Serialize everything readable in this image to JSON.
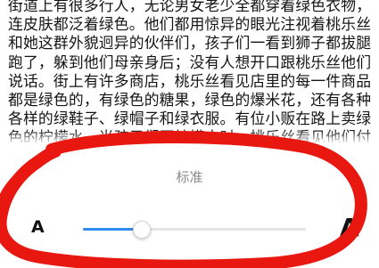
{
  "reader": {
    "paragraph": "街道上有很多行人，无论男女老少全都穿着绿色衣物，连皮肤都泛着绿色。他们都用惊异的眼光注视着桃乐丝和她这群外貌迥异的伙伴们，孩子们一看到狮子都拔腿跑了，躲到他们母亲身后；没有人想开口跟桃乐丝他们说话。街上有许多商店，桃乐丝看见店里的每一件商品都是绿色的，有绿色的糖果，绿色的爆米花，还有各种各样的绿鞋子、绿帽子和绿衣服。有位小贩在路上卖绿色的柠檬水，当孩子们买柠檬水时，桃乐丝看见他们付的钱也是绿色的。"
  },
  "font_size_panel": {
    "current_label": "标准",
    "small_label": "A",
    "large_label": "A",
    "level": 0.26
  },
  "colors": {
    "accent": "#2f8cf0",
    "annotation": "#e8170f"
  }
}
